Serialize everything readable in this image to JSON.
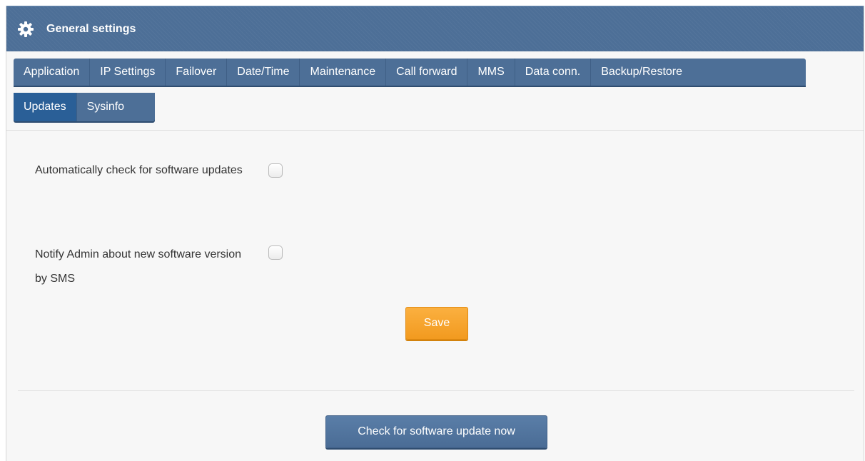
{
  "header": {
    "title": "General settings",
    "icon": "gear-icon",
    "background_color": "#4d6f97"
  },
  "tabs": {
    "row1": [
      {
        "label": "Application"
      },
      {
        "label": "IP Settings"
      },
      {
        "label": "Failover"
      },
      {
        "label": "Date/Time"
      },
      {
        "label": "Maintenance"
      },
      {
        "label": "Call forward"
      },
      {
        "label": "MMS"
      },
      {
        "label": "Data conn."
      },
      {
        "label": "Backup/Restore"
      }
    ],
    "row2": [
      {
        "label": "Updates"
      },
      {
        "label": "Sysinfo"
      }
    ],
    "active": "Updates",
    "active_color": "#2a5f97"
  },
  "settings": {
    "auto_check": {
      "label": "Automatically check for software updates",
      "checked": false
    },
    "notify_admin": {
      "label": "Notify Admin about new software version by SMS",
      "checked": false
    }
  },
  "buttons": {
    "save_label": "Save",
    "save_color": "#f7a52e",
    "check_update_label": "Check for software update now",
    "check_update_color": "#52759f"
  }
}
